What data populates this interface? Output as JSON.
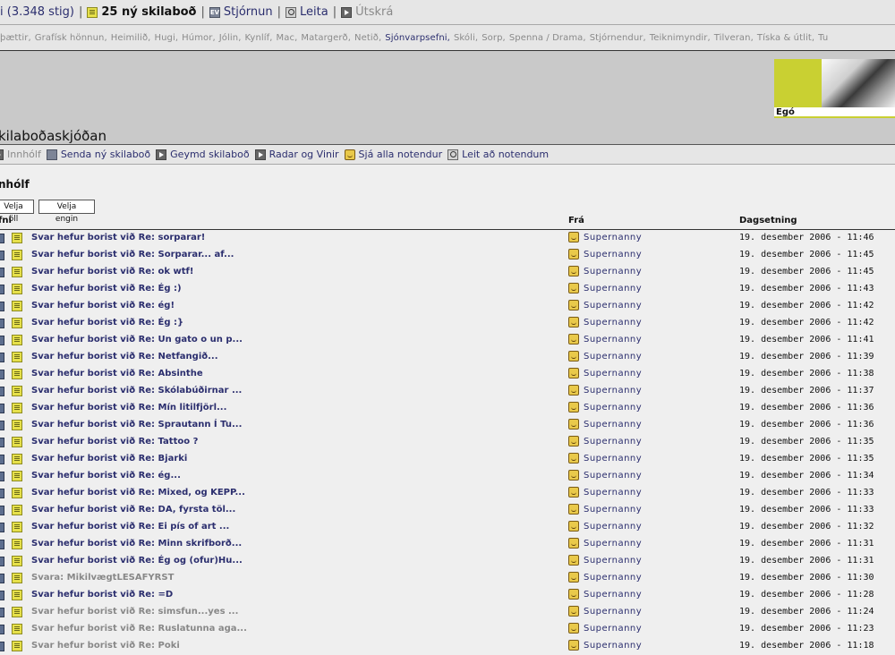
{
  "topbar": {
    "user_points": "i (3.348 stig)",
    "new_messages": "25 ný skilaboð",
    "admin": "Stjórnun",
    "search": "Leita",
    "logout": "Útskrá"
  },
  "categories": [
    "þættir,",
    "Grafísk hönnun,",
    "Heimilið,",
    "Hugi,",
    "Húmor,",
    "Jólin,",
    "Kynlíf,",
    "Mac,",
    "Matargerð,",
    "Netið,",
    "Sjónvarpsefni,",
    "Skóli,",
    "Sorp,",
    "Spenna / Drama,",
    "Stjórnendur,",
    "Teiknimyndir,",
    "Tilveran,",
    "Tíska & útlit,",
    "Tu"
  ],
  "categories_highlight_index": 10,
  "ego": {
    "label": "Egó"
  },
  "page_title": "kilaboðaskjóðan",
  "nav": {
    "inbox": "Innhólf",
    "send": "Senda ný skilaboð",
    "saved": "Geymd skilaboð",
    "radar": "Radar og Vinir",
    "all_users": "Sjá alla notendur",
    "search_users": "Leit að notendum"
  },
  "section_title": "nhólf",
  "buttons": {
    "select_all": "Velja öll",
    "select_none": "Velja engin"
  },
  "table": {
    "col_subject": "fni",
    "col_from": "Frá",
    "col_date": "Dagsetning",
    "rows": [
      {
        "subject": "Svar hefur borist við Re: sorparar!",
        "from": "Supernanny",
        "date": "19. desember 2006 - 11:46",
        "read": false
      },
      {
        "subject": "Svar hefur borist við Re: Sorparar... af...",
        "from": "Supernanny",
        "date": "19. desember 2006 - 11:45",
        "read": false
      },
      {
        "subject": "Svar hefur borist við Re: ok wtf!",
        "from": "Supernanny",
        "date": "19. desember 2006 - 11:45",
        "read": false
      },
      {
        "subject": "Svar hefur borist við Re: Ég :)",
        "from": "Supernanny",
        "date": "19. desember 2006 - 11:43",
        "read": false
      },
      {
        "subject": "Svar hefur borist við Re: ég!",
        "from": "Supernanny",
        "date": "19. desember 2006 - 11:42",
        "read": false
      },
      {
        "subject": "Svar hefur borist við Re: Ég :}",
        "from": "Supernanny",
        "date": "19. desember 2006 - 11:42",
        "read": false
      },
      {
        "subject": "Svar hefur borist við Re: Un gato o un p...",
        "from": "Supernanny",
        "date": "19. desember 2006 - 11:41",
        "read": false
      },
      {
        "subject": "Svar hefur borist við Re: Netfangið...",
        "from": "Supernanny",
        "date": "19. desember 2006 - 11:39",
        "read": false
      },
      {
        "subject": "Svar hefur borist við Re: Absinthe",
        "from": "Supernanny",
        "date": "19. desember 2006 - 11:38",
        "read": false
      },
      {
        "subject": "Svar hefur borist við Re: Skólabúðirnar ...",
        "from": "Supernanny",
        "date": "19. desember 2006 - 11:37",
        "read": false
      },
      {
        "subject": "Svar hefur borist við Re: Mín litilfjörl...",
        "from": "Supernanny",
        "date": "19. desember 2006 - 11:36",
        "read": false
      },
      {
        "subject": "Svar hefur borist við Re: Sprautann Í Tu...",
        "from": "Supernanny",
        "date": "19. desember 2006 - 11:36",
        "read": false
      },
      {
        "subject": "Svar hefur borist við Re: Tattoo ?",
        "from": "Supernanny",
        "date": "19. desember 2006 - 11:35",
        "read": false
      },
      {
        "subject": "Svar hefur borist við Re: Bjarki",
        "from": "Supernanny",
        "date": "19. desember 2006 - 11:35",
        "read": false
      },
      {
        "subject": "Svar hefur borist við Re: ég...",
        "from": "Supernanny",
        "date": "19. desember 2006 - 11:34",
        "read": false
      },
      {
        "subject": "Svar hefur borist við Re: Mixed, og KEPP...",
        "from": "Supernanny",
        "date": "19. desember 2006 - 11:33",
        "read": false
      },
      {
        "subject": "Svar hefur borist við Re: DA, fyrsta töl...",
        "from": "Supernanny",
        "date": "19. desember 2006 - 11:33",
        "read": false
      },
      {
        "subject": "Svar hefur borist við Re: Ei pís of art ...",
        "from": "Supernanny",
        "date": "19. desember 2006 - 11:32",
        "read": false
      },
      {
        "subject": "Svar hefur borist við Re: Minn skrifborð...",
        "from": "Supernanny",
        "date": "19. desember 2006 - 11:31",
        "read": false
      },
      {
        "subject": "Svar hefur borist við Re: Ég og (ofur)Hu...",
        "from": "Supernanny",
        "date": "19. desember 2006 - 11:31",
        "read": false
      },
      {
        "subject": "Svara: MikilvægtLESAFYRST",
        "from": "Supernanny",
        "date": "19. desember 2006 - 11:30",
        "read": true
      },
      {
        "subject": "Svar hefur borist við Re: =D",
        "from": "Supernanny",
        "date": "19. desember 2006 - 11:28",
        "read": false
      },
      {
        "subject": "Svar hefur borist við Re: simsfun...yes ...",
        "from": "Supernanny",
        "date": "19. desember 2006 - 11:24",
        "read": true
      },
      {
        "subject": "Svar hefur borist við Re: Ruslatunna aga...",
        "from": "Supernanny",
        "date": "19. desember 2006 - 11:23",
        "read": true
      },
      {
        "subject": "Svar hefur borist við Re: Poki",
        "from": "Supernanny",
        "date": "19. desember 2006 - 11:18",
        "read": true
      }
    ]
  }
}
